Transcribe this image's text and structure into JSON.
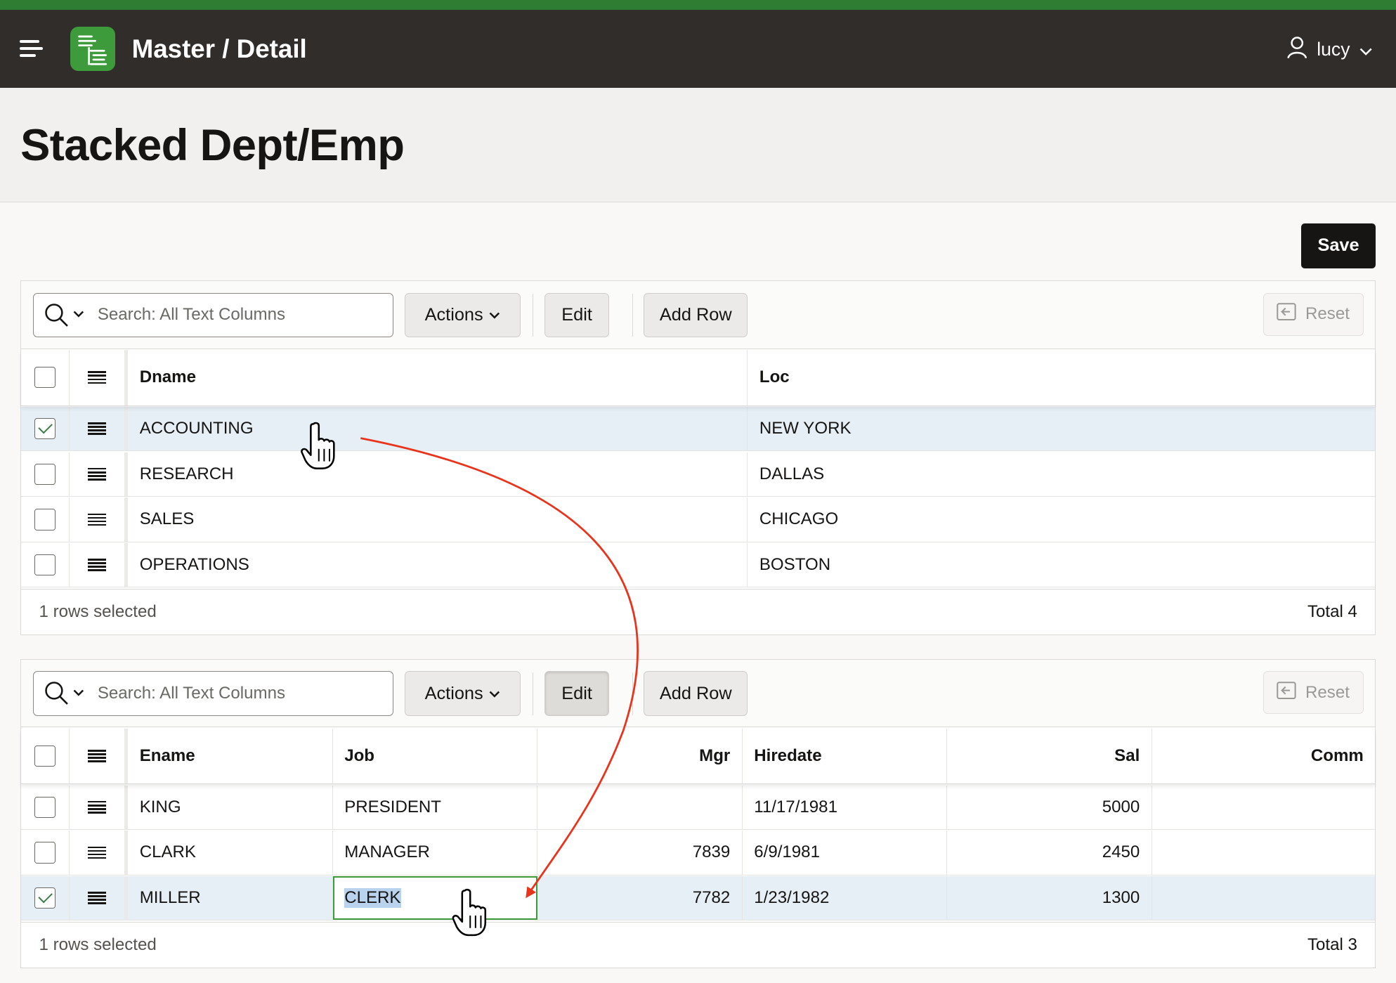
{
  "header": {
    "app_title": "Master / Detail",
    "user": "lucy",
    "icons": [
      "hamburger-icon",
      "app-logo-icon",
      "user-icon",
      "chevron-down-icon"
    ]
  },
  "page": {
    "title": "Stacked Dept/Emp",
    "save_label": "Save"
  },
  "dept_grid": {
    "search_placeholder": "Search: All Text Columns",
    "actions_label": "Actions",
    "edit_label": "Edit",
    "add_row_label": "Add Row",
    "reset_label": "Reset",
    "columns": {
      "dname": "Dname",
      "loc": "Loc"
    },
    "rows": [
      {
        "dname": "ACCOUNTING",
        "loc": "NEW YORK",
        "selected": true
      },
      {
        "dname": "RESEARCH",
        "loc": "DALLAS",
        "selected": false
      },
      {
        "dname": "SALES",
        "loc": "CHICAGO",
        "selected": false
      },
      {
        "dname": "OPERATIONS",
        "loc": "BOSTON",
        "selected": false
      }
    ],
    "status": "1 rows selected",
    "total": "Total 4"
  },
  "emp_grid": {
    "search_placeholder": "Search: All Text Columns",
    "actions_label": "Actions",
    "edit_label": "Edit",
    "add_row_label": "Add Row",
    "reset_label": "Reset",
    "columns": {
      "ename": "Ename",
      "job": "Job",
      "mgr": "Mgr",
      "hiredate": "Hiredate",
      "sal": "Sal",
      "comm": "Comm"
    },
    "rows": [
      {
        "ename": "KING",
        "job": "PRESIDENT",
        "mgr": "",
        "hiredate": "11/17/1981",
        "sal": "5000",
        "comm": "",
        "selected": false
      },
      {
        "ename": "CLARK",
        "job": "MANAGER",
        "mgr": "7839",
        "hiredate": "6/9/1981",
        "sal": "2450",
        "comm": "",
        "selected": false
      },
      {
        "ename": "MILLER",
        "job": "CLERK",
        "mgr": "7782",
        "hiredate": "1/23/1982",
        "sal": "1300",
        "comm": "",
        "selected": true
      }
    ],
    "status": "1 rows selected",
    "total": "Total 3"
  },
  "colors": {
    "accent_green": "#3d9b3b",
    "header_bg": "#312d2a",
    "selected_row": "#e6eff5",
    "annotation_arrow": "#e8341c"
  }
}
